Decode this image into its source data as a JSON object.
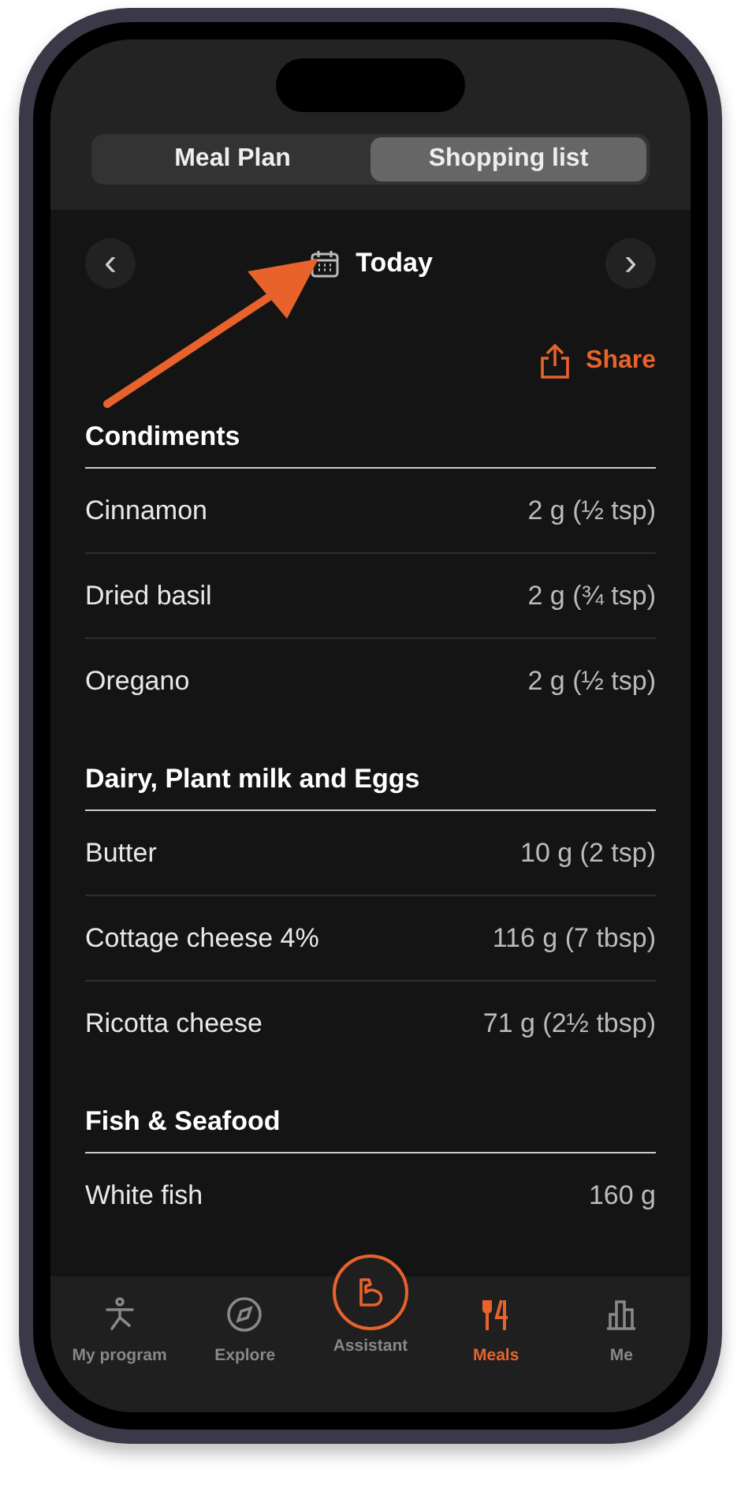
{
  "segments": [
    {
      "label": "Meal Plan",
      "selected": false
    },
    {
      "label": "Shopping list",
      "selected": true
    }
  ],
  "date": {
    "prev": "‹",
    "label": "Today",
    "next": "›"
  },
  "share": "Share",
  "sections": [
    {
      "title": "Condiments",
      "items": [
        {
          "name": "Cinnamon",
          "amount": "2 g (½ tsp)"
        },
        {
          "name": "Dried basil",
          "amount": "2 g (¾ tsp)"
        },
        {
          "name": "Oregano",
          "amount": "2 g (½ tsp)"
        }
      ]
    },
    {
      "title": "Dairy, Plant milk and Eggs",
      "items": [
        {
          "name": "Butter",
          "amount": "10 g (2 tsp)"
        },
        {
          "name": "Cottage cheese 4%",
          "amount": "116 g (7 tbsp)"
        },
        {
          "name": "Ricotta cheese",
          "amount": "71 g (2½ tbsp)"
        }
      ]
    },
    {
      "title": "Fish & Seafood",
      "items": [
        {
          "name": "White fish",
          "amount": "160 g"
        }
      ]
    }
  ],
  "tabbar": [
    {
      "kind": "program",
      "label": "My program",
      "selected": false
    },
    {
      "kind": "explore",
      "label": "Explore",
      "selected": false
    },
    {
      "kind": "assistant",
      "label": "Assistant",
      "selected": false
    },
    {
      "kind": "meals",
      "label": "Meals",
      "selected": true
    },
    {
      "kind": "me",
      "label": "Me",
      "selected": false
    }
  ]
}
